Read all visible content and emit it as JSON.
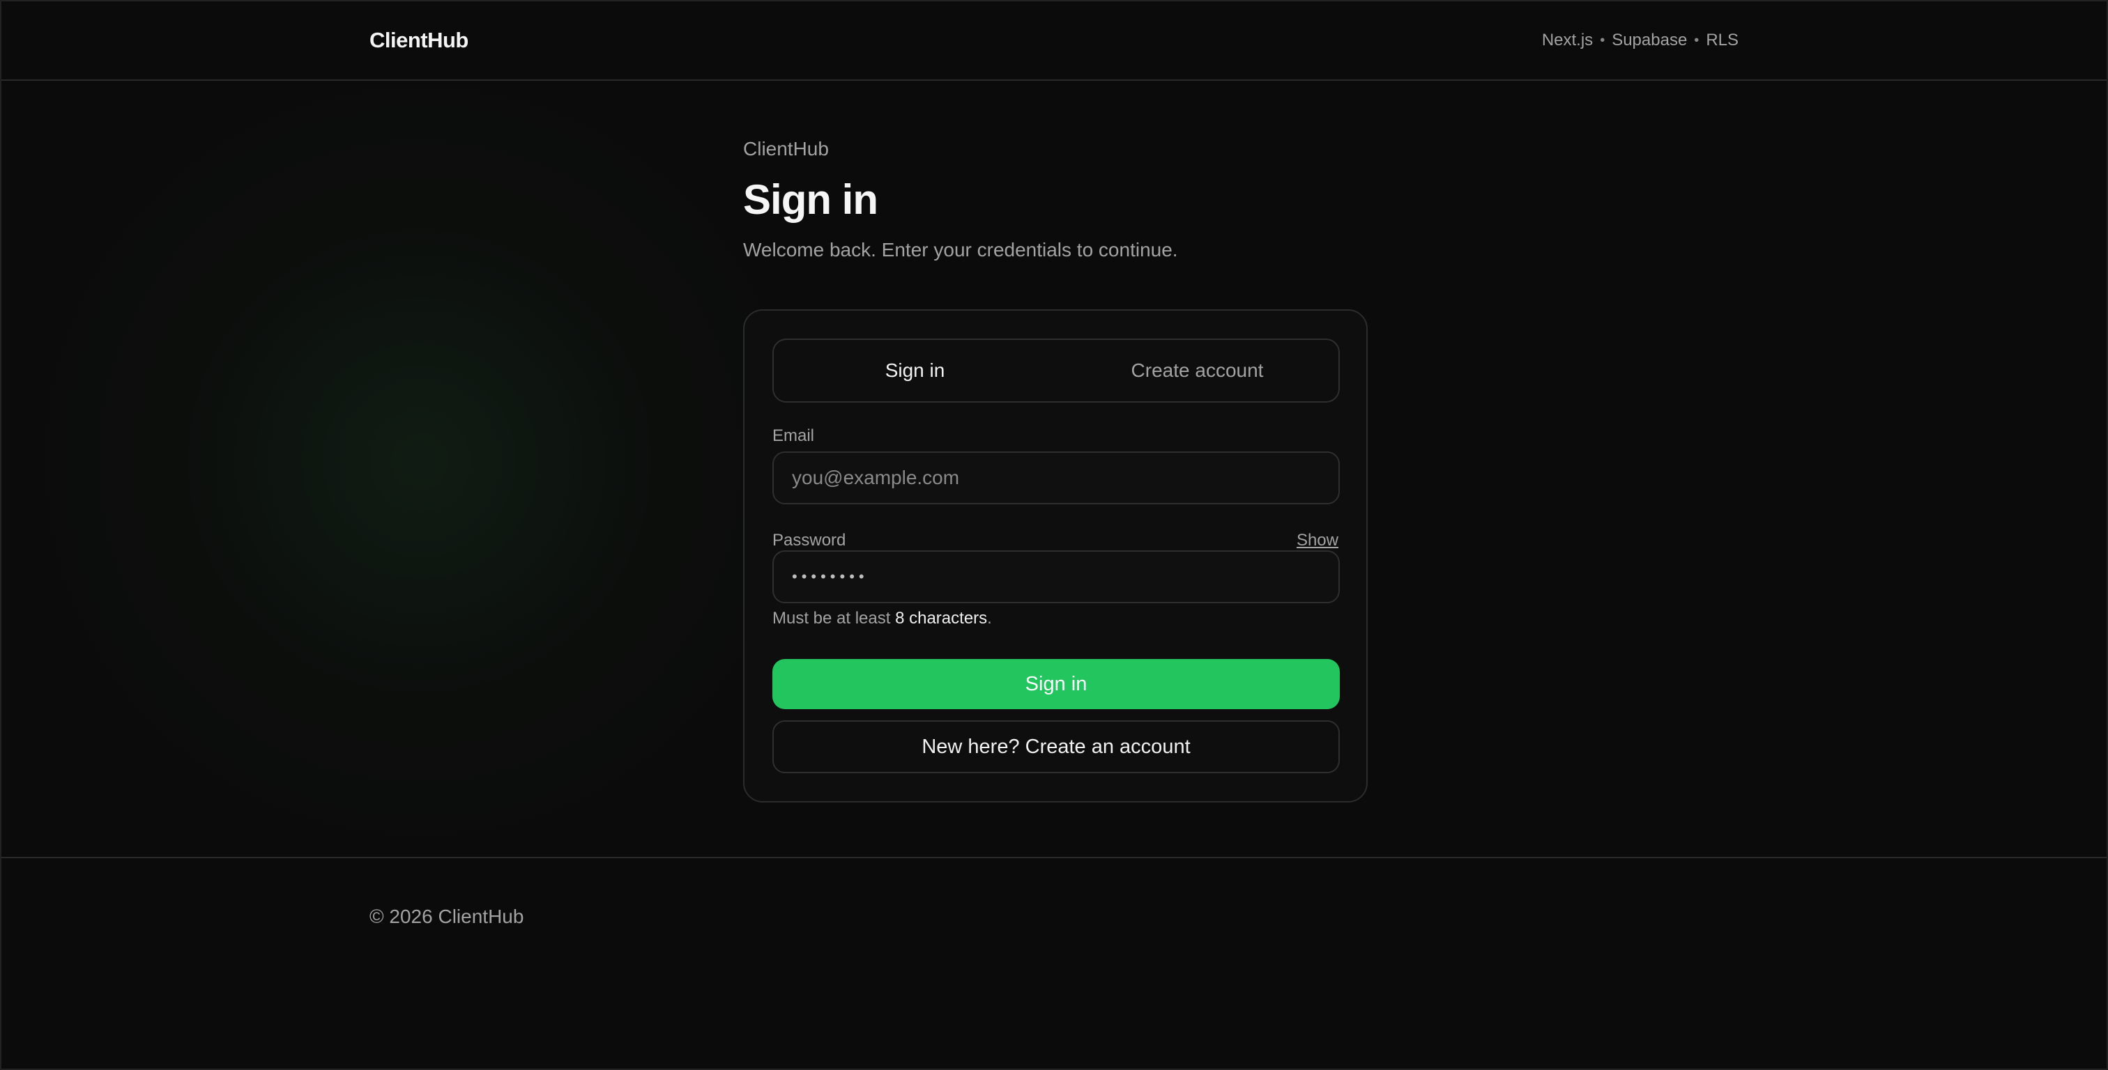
{
  "header": {
    "brand": "ClientHub",
    "stack": [
      "Next.js",
      "Supabase",
      "RLS"
    ],
    "separator": "•"
  },
  "intro": {
    "eyebrow": "ClientHub",
    "title": "Sign in",
    "subtitle": "Welcome back. Enter your credentials to continue."
  },
  "tabs": [
    {
      "label": "Sign in",
      "active": true
    },
    {
      "label": "Create account",
      "active": false
    }
  ],
  "form": {
    "email_label": "Email",
    "email_placeholder": "you@example.com",
    "email_value": "",
    "password_label": "Password",
    "password_mask": "••••••••",
    "show_label": "Show",
    "hint_prefix": "Must be at least ",
    "hint_strong": "8 characters",
    "hint_suffix": ".",
    "submit_label": "Sign in",
    "secondary_label": "New here? Create an account"
  },
  "footer": {
    "copyright": "© 2026 ClientHub"
  },
  "colors": {
    "accent": "#22c55e",
    "background": "#0b0b0b"
  }
}
